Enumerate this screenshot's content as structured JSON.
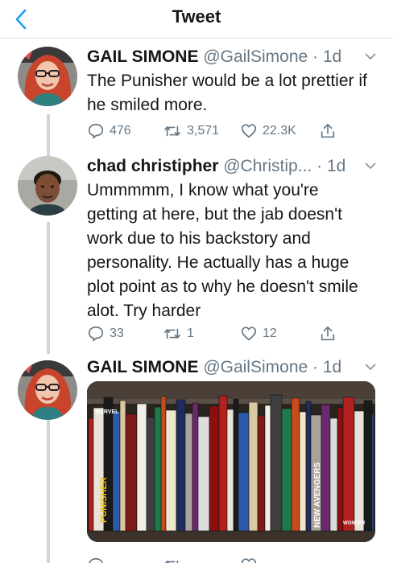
{
  "nav": {
    "title": "Tweet"
  },
  "tweets": [
    {
      "name": "GAIL SIMONE",
      "handle": "@GailSimone",
      "time": "· 1d",
      "text": "The Punisher would be a lot prettier if he smiled more.",
      "replies": "476",
      "retweets": "3,571",
      "likes": "22.3K"
    },
    {
      "name": "chad christipher",
      "handle": "@Christip...",
      "time": " · 1d",
      "text": "Ummmmm, I know what you're getting at here, but the jab doesn't work due to his backstory and personality. He actually has a huge plot point as to why he doesn't smile alot. Try harder",
      "replies": "33",
      "retweets": "1",
      "likes": "12"
    },
    {
      "name": "GAIL SIMONE",
      "handle": "@GailSimone",
      "time": "· 1d"
    }
  ],
  "media": {
    "book_label_1": "MARVEL",
    "book_label_2": "PUNISHER",
    "book_label_3": "NEW AVENGERS",
    "book_label_4": "WONDER"
  },
  "colors": {
    "text": "#14171a",
    "secondary": "#657786",
    "accent": "#1da1f2",
    "line": "#ccd6dd"
  },
  "icons": [
    "back-chevron-icon",
    "chevron-down-icon",
    "reply-icon",
    "retweet-icon",
    "like-icon",
    "share-icon"
  ]
}
